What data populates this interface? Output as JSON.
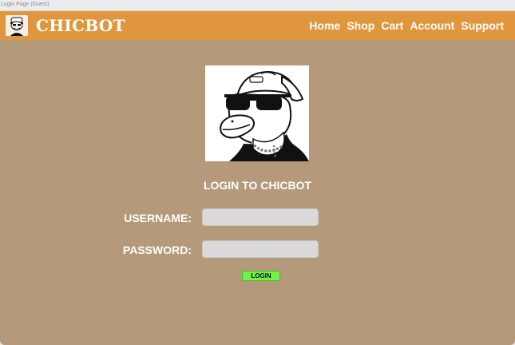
{
  "window": {
    "title": "Login Page (Guest)"
  },
  "brand": {
    "name": "CHICBOT",
    "logo_icon": "duck-mascot-icon"
  },
  "nav": {
    "items": [
      {
        "label": "Home"
      },
      {
        "label": "Shop"
      },
      {
        "label": "Cart"
      },
      {
        "label": "Account"
      },
      {
        "label": "Support"
      }
    ]
  },
  "hero": {
    "image": "duck-with-sunglasses-illustration"
  },
  "login": {
    "title": "LOGIN TO CHICBOT",
    "username_label": "USERNAME:",
    "username_value": "",
    "password_label": "PASSWORD:",
    "password_value": "",
    "button_label": "LOGIN"
  },
  "colors": {
    "navbar": "#e0963c",
    "background": "#b4997a",
    "button": "#6ff24a",
    "input": "#d9d9d9"
  }
}
